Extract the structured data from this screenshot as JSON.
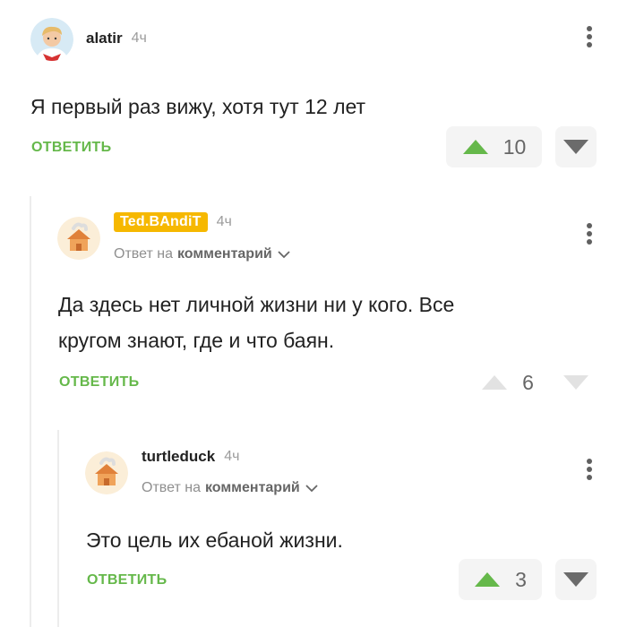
{
  "comments": [
    {
      "author": "alatir",
      "time": "4ч",
      "reply_to": null,
      "text": "Я первый раз вижу, хотя тут 12 лет",
      "reply_label": "ОТВЕТИТЬ",
      "rating": "10",
      "upvoted": true,
      "avatar_icon": "boy-avatar-icon",
      "colors": {
        "upvote": "#65b84a"
      }
    },
    {
      "author": "Ted.BAndiT",
      "author_badge": true,
      "time": "4ч",
      "reply_prefix": "Ответ на",
      "reply_target": "комментарий",
      "text_lines": [
        "Да здесь нет личной жизни ни у кого. Все",
        "кругом знают, где и что баян."
      ],
      "reply_label": "ОТВЕТИТЬ",
      "rating": "6",
      "upvoted": false,
      "avatar_icon": "house-avatar-icon"
    },
    {
      "author": "turtleduck",
      "time": "4ч",
      "reply_prefix": "Ответ на",
      "reply_target": "комментарий",
      "text": "Это цель их ебаной жизни.",
      "reply_label": "ОТВЕТИТЬ",
      "rating": "3",
      "upvoted": true,
      "avatar_icon": "house-avatar-icon"
    }
  ],
  "colors": {
    "accent_green": "#65b84a",
    "badge_yellow": "#f6b800",
    "muted_gray": "#9c9c9c"
  }
}
